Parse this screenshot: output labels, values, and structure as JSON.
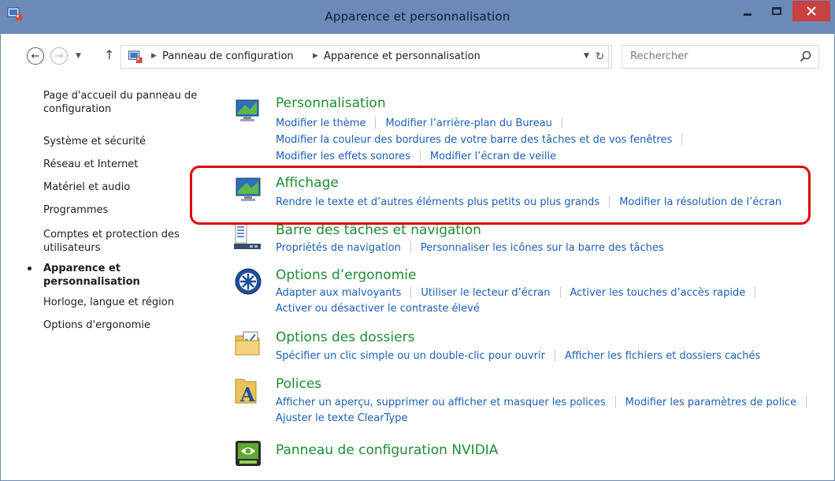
{
  "window": {
    "title": "Apparence et personnalisation"
  },
  "address": {
    "breadcrumbs": [
      "Panneau de configuration",
      "Apparence et personnalisation"
    ],
    "search_placeholder": "Rechercher"
  },
  "leftnav": {
    "items": [
      {
        "label": "Page d'accueil du panneau de configuration",
        "active": false
      },
      {
        "label": "Système et sécurité",
        "active": false
      },
      {
        "label": "Réseau et Internet",
        "active": false
      },
      {
        "label": "Matériel et audio",
        "active": false
      },
      {
        "label": "Programmes",
        "active": false
      },
      {
        "label": "Comptes et protection des utilisateurs",
        "active": false
      },
      {
        "label": "Apparence et personnalisation",
        "active": true
      },
      {
        "label": "Horloge, langue et région",
        "active": false
      },
      {
        "label": "Options d'ergonomie",
        "active": false
      }
    ]
  },
  "categories": [
    {
      "title": "Personnalisation",
      "icon": "personalization-icon",
      "links": [
        "Modifier le thème",
        "Modifier l’arrière-plan du Bureau",
        "Modifier la couleur des bordures de votre barre des tâches et de vos fenêtres",
        "Modifier les effets sonores",
        "Modifier l’écran de veille"
      ]
    },
    {
      "title": "Affichage",
      "icon": "display-icon",
      "links": [
        "Rendre le texte et d’autres éléments plus petits ou plus grands",
        "Modifier la résolution de l’écran"
      ]
    },
    {
      "title": "Barre des tâches et navigation",
      "icon": "taskbar-icon",
      "links": [
        "Propriétés de navigation",
        "Personnaliser les icônes sur la barre des tâches"
      ]
    },
    {
      "title": "Options d’ergonomie",
      "icon": "ease-of-access-icon",
      "links": [
        "Adapter aux malvoyants",
        "Utiliser le lecteur d’écran",
        "Activer les touches d’accès rapide",
        "Activer ou désactiver le contraste élevé"
      ]
    },
    {
      "title": "Options des dossiers",
      "icon": "folder-options-icon",
      "links": [
        "Spécifier un clic simple ou un double-clic pour ouvrir",
        "Afficher les fichiers et dossiers cachés"
      ]
    },
    {
      "title": "Polices",
      "icon": "fonts-icon",
      "links": [
        "Afficher un aperçu, supprimer ou afficher et masquer les polices",
        "Modifier les paramètres de police",
        "Ajuster le texte ClearType"
      ]
    },
    {
      "title": "Panneau de configuration NVIDIA",
      "icon": "nvidia-icon",
      "links": []
    }
  ],
  "colors": {
    "titlebar": "#6b8ab5",
    "close_button": "#c74141",
    "category_title": "#1e8d34",
    "link": "#1a5fb4",
    "highlight": "#e00000"
  }
}
